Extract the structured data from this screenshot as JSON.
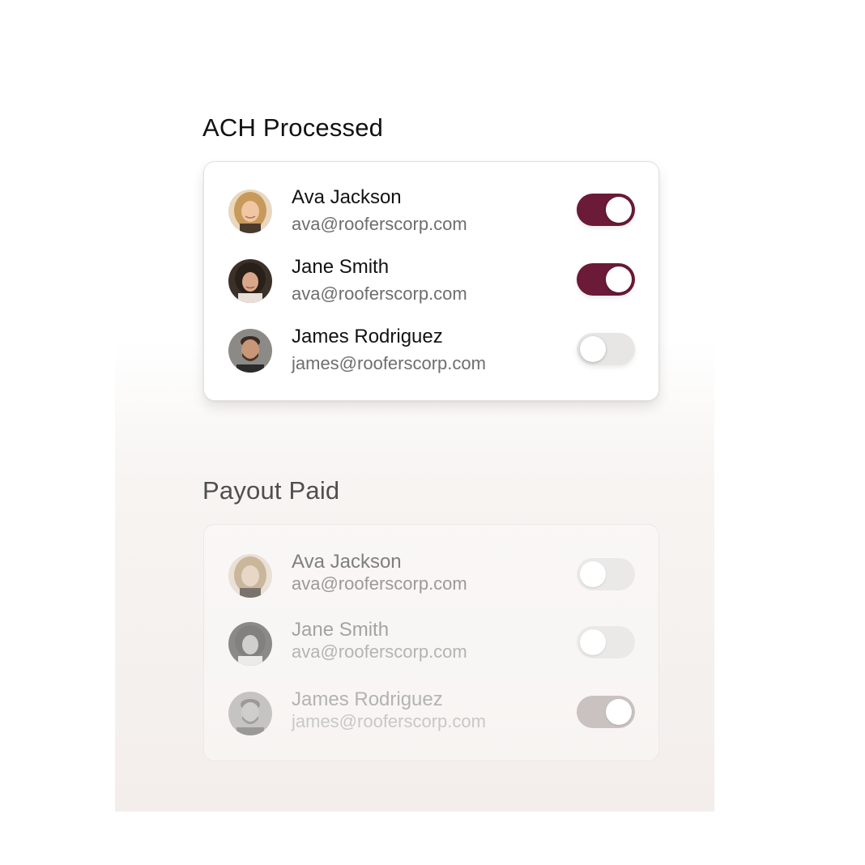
{
  "sections": [
    {
      "title": "ACH Processed",
      "contacts": [
        {
          "name": "Ava Jackson",
          "email": "ava@rooferscorp.com",
          "toggle_on": true,
          "avatar": "woman-blonde-avatar"
        },
        {
          "name": "Jane Smith",
          "email": "ava@rooferscorp.com",
          "toggle_on": true,
          "avatar": "woman-curly-avatar"
        },
        {
          "name": "James Rodriguez",
          "email": "james@rooferscorp.com",
          "toggle_on": false,
          "avatar": "man-beard-avatar"
        }
      ]
    },
    {
      "title": "Payout Paid",
      "contacts": [
        {
          "name": "Ava Jackson",
          "email": "ava@rooferscorp.com",
          "toggle_on": false,
          "avatar": "woman-blonde-avatar"
        },
        {
          "name": "Jane Smith",
          "email": "ava@rooferscorp.com",
          "toggle_on": false,
          "avatar": "woman-curly-avatar"
        },
        {
          "name": "James Rodriguez",
          "email": "james@rooferscorp.com",
          "toggle_on": true,
          "avatar": "man-beard-avatar"
        }
      ]
    }
  ],
  "colors": {
    "toggle_on": "#6b1a38",
    "toggle_off": "#e7e6e5",
    "toggle_on_faded": "#c5bebd",
    "backdrop": "#f5f1ef"
  }
}
